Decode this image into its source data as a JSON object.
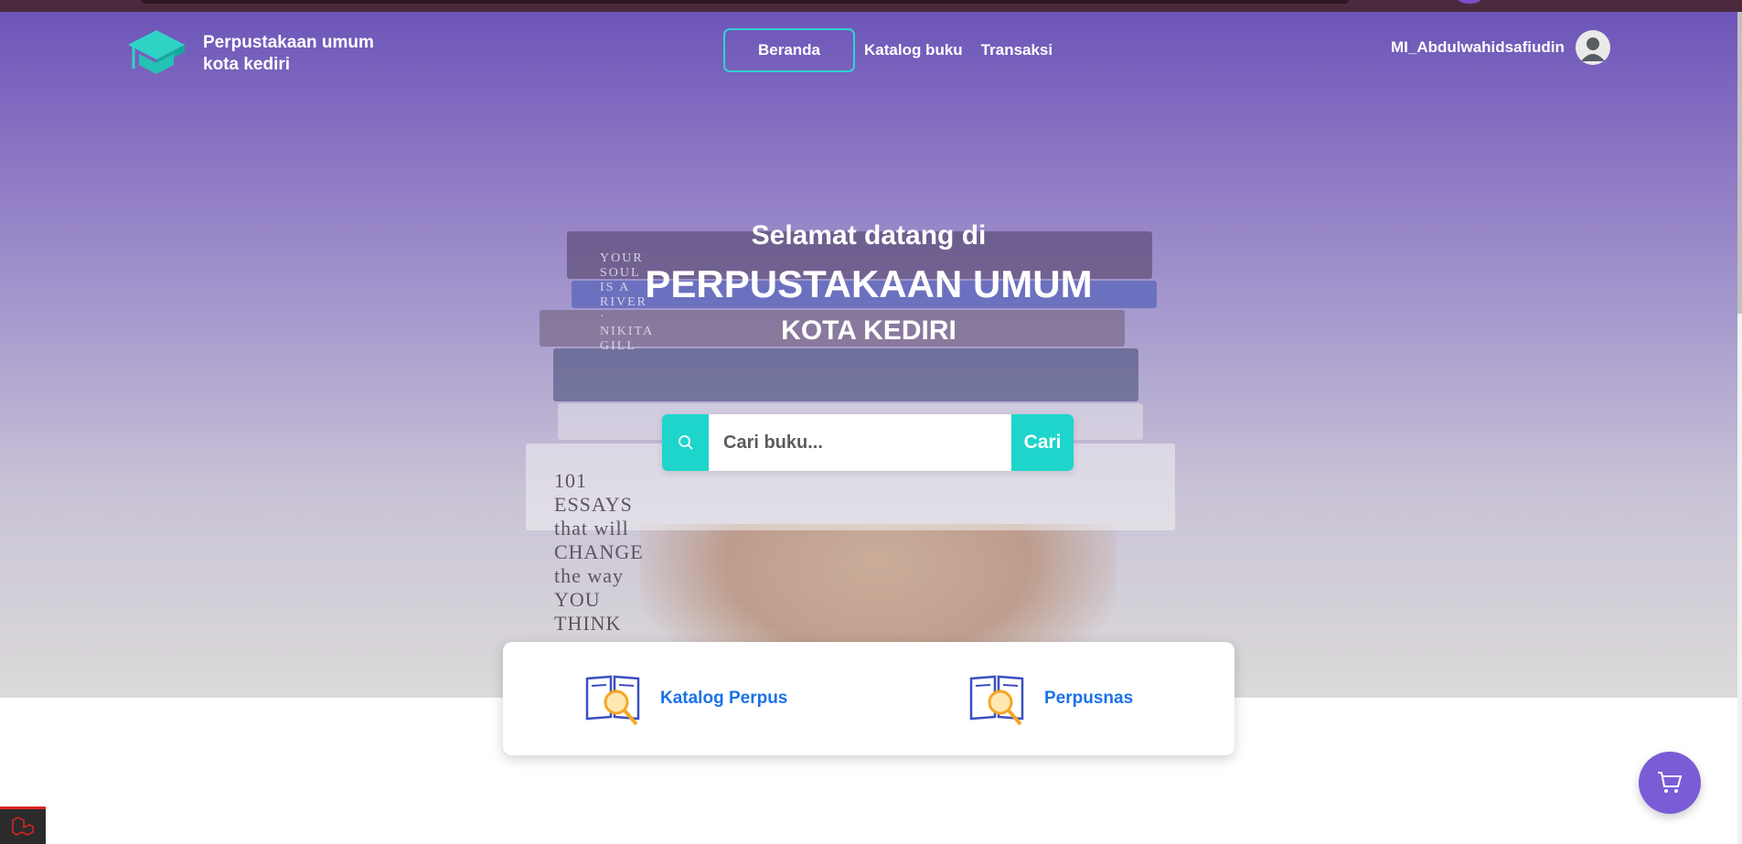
{
  "brand": {
    "line1": "Perpustakaan umum",
    "line2": "kota kediri"
  },
  "nav": {
    "items": [
      "Beranda",
      "Katalog buku",
      "Transaksi"
    ],
    "active": "Beranda"
  },
  "user": {
    "name": "MI_Abdulwahidsafiudin"
  },
  "hero": {
    "line1": "Selamat datang di",
    "line2": "PERPUSTAKAAN UMUM",
    "line3": "KOTA KEDIRI",
    "book_spines": [
      "YOUR SOUL IS A RIVER · NIKITA GILL",
      "101 ESSAYS that will CHANGE the way YOU THINK"
    ]
  },
  "search": {
    "placeholder": "Cari buku...",
    "button_label": "Cari"
  },
  "cards": [
    {
      "label": "Katalog Perpus",
      "icon": "book-search-icon"
    },
    {
      "label": "Perpusnas",
      "icon": "book-search-icon"
    }
  ],
  "icons": {
    "search": "search-icon",
    "cart": "cart-icon",
    "logo": "graduation-cap-icon",
    "avatar": "user-avatar-icon"
  },
  "colors": {
    "primary": "#6c55b8",
    "accent": "#1ed5cc",
    "link": "#1a73e8",
    "cart": "#7a5cd6"
  }
}
